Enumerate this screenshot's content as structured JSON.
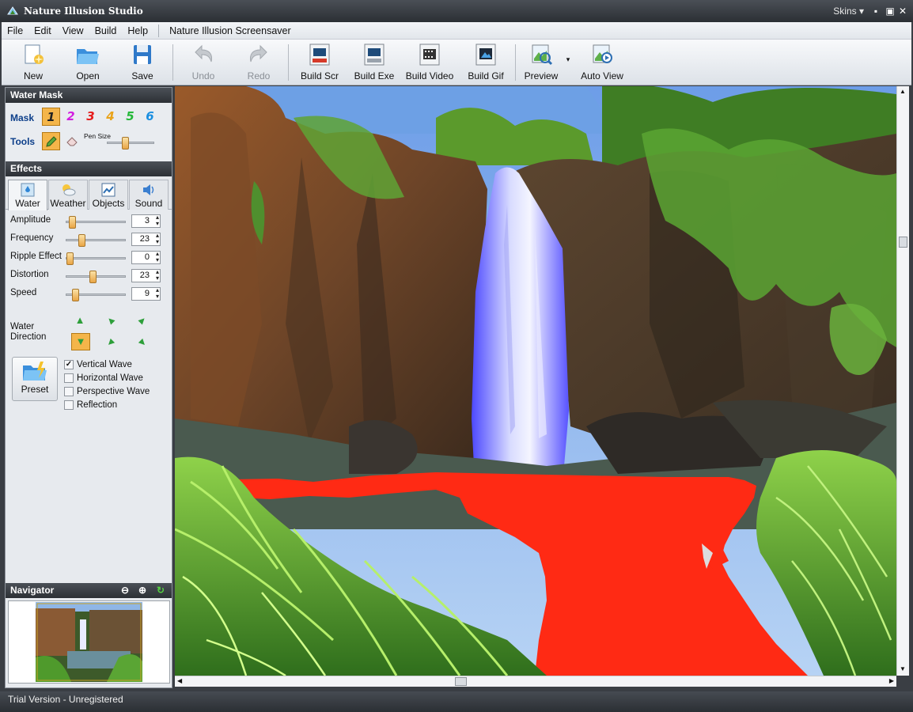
{
  "window": {
    "title": "Nature Illusion Studio",
    "skins_label": "Skins"
  },
  "menu": {
    "items": [
      "File",
      "Edit",
      "View",
      "Build",
      "Help"
    ],
    "extra": "Nature Illusion Screensaver"
  },
  "toolbar": {
    "new": "New",
    "open": "Open",
    "save": "Save",
    "undo": "Undo",
    "redo": "Redo",
    "build_scr": "Build Scr",
    "build_exe": "Build Exe",
    "build_video": "Build Video",
    "build_gif": "Build Gif",
    "preview": "Preview",
    "auto_view": "Auto View"
  },
  "water_mask": {
    "header": "Water Mask",
    "mask_label": "Mask",
    "tools_label": "Tools",
    "masks": [
      "1",
      "2",
      "3",
      "4",
      "5",
      "6"
    ],
    "selected_mask": "1",
    "pen_size_label": "Pen Size",
    "pen_size": 0.35
  },
  "effects": {
    "header": "Effects",
    "tabs": [
      "Water",
      "Weather",
      "Objects",
      "Sound"
    ],
    "selected_tab": "Water",
    "params": [
      {
        "label": "Amplitude",
        "value": "3",
        "position": 0.04
      },
      {
        "label": "Frequency",
        "value": "23",
        "position": 0.23
      },
      {
        "label": "Ripple Effect",
        "value": "0",
        "position": 0.0
      },
      {
        "label": "Distortion",
        "value": "23",
        "position": 0.43
      },
      {
        "label": "Speed",
        "value": "9",
        "position": 0.1
      }
    ],
    "water_direction_label": "Water Direction",
    "selected_direction": "down",
    "preset_label": "Preset",
    "options": [
      {
        "label": "Vertical Wave",
        "checked": true
      },
      {
        "label": "Horizontal Wave",
        "checked": false
      },
      {
        "label": "Perspective Wave",
        "checked": false
      },
      {
        "label": "Reflection",
        "checked": false
      }
    ]
  },
  "navigator": {
    "header": "Navigator"
  },
  "status": {
    "text": "Trial Version - Unregistered"
  },
  "colors": {
    "mask_overlay": "#ff2a14",
    "selection": "#f4b54a",
    "dark_chrome": "#2c3035",
    "waterfall_tint": "#5a5cff"
  }
}
